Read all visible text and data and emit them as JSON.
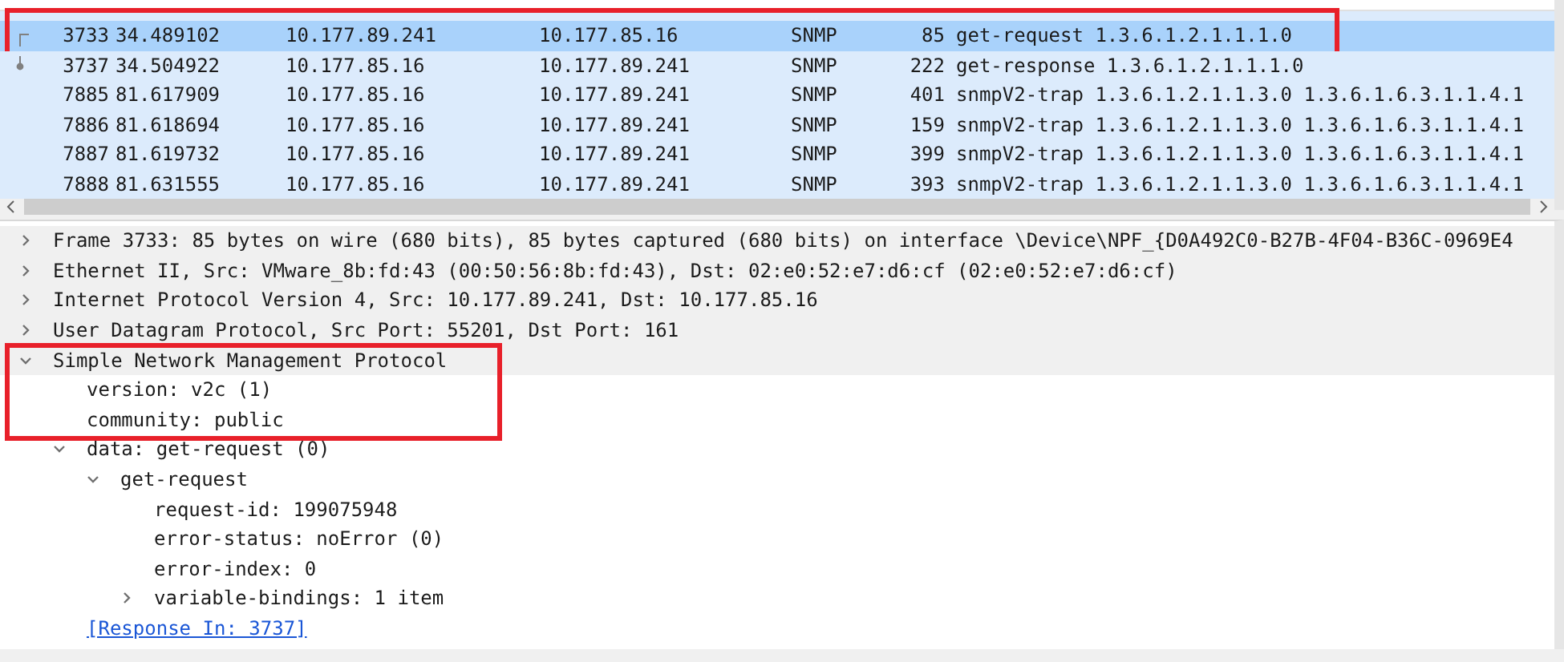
{
  "packet_list": {
    "rows": [
      {
        "no": "3733",
        "time": "34.489102",
        "source": "10.177.89.241",
        "destination": "10.177.85.16",
        "protocol": "SNMP",
        "length": "85",
        "info": "get-request 1.3.6.1.2.1.1.1.0",
        "selected": true,
        "highlighted": true,
        "request_mark": true,
        "response_mark": false
      },
      {
        "no": "3737",
        "time": "34.504922",
        "source": "10.177.85.16",
        "destination": "10.177.89.241",
        "protocol": "SNMP",
        "length": "222",
        "info": "get-response 1.3.6.1.2.1.1.1.0",
        "selected": false,
        "highlighted": false,
        "request_mark": false,
        "response_mark": true
      },
      {
        "no": "7885",
        "time": "81.617909",
        "source": "10.177.85.16",
        "destination": "10.177.89.241",
        "protocol": "SNMP",
        "length": "401",
        "info": "snmpV2-trap 1.3.6.1.2.1.1.3.0 1.3.6.1.6.3.1.1.4.1",
        "selected": false,
        "highlighted": false,
        "request_mark": false,
        "response_mark": false
      },
      {
        "no": "7886",
        "time": "81.618694",
        "source": "10.177.85.16",
        "destination": "10.177.89.241",
        "protocol": "SNMP",
        "length": "159",
        "info": "snmpV2-trap 1.3.6.1.2.1.1.3.0 1.3.6.1.6.3.1.1.4.1",
        "selected": false,
        "highlighted": false,
        "request_mark": false,
        "response_mark": false
      },
      {
        "no": "7887",
        "time": "81.619732",
        "source": "10.177.85.16",
        "destination": "10.177.89.241",
        "protocol": "SNMP",
        "length": "399",
        "info": "snmpV2-trap 1.3.6.1.2.1.1.3.0 1.3.6.1.6.3.1.1.4.1",
        "selected": false,
        "highlighted": false,
        "request_mark": false,
        "response_mark": false
      },
      {
        "no": "7888",
        "time": "81.631555",
        "source": "10.177.85.16",
        "destination": "10.177.89.241",
        "protocol": "SNMP",
        "length": "393",
        "info": "snmpV2-trap 1.3.6.1.2.1.1.3.0 1.3.6.1.6.3.1.1.4.1",
        "selected": false,
        "highlighted": false,
        "request_mark": false,
        "response_mark": false
      }
    ]
  },
  "packet_details": [
    {
      "label": "Frame 3733: 85 bytes on wire (680 bits), 85 bytes captured (680 bits) on interface \\Device\\NPF_{D0A492C0-B27B-4F04-B36C-0969E4",
      "expanded": false,
      "shaded": true,
      "highlighted": false
    },
    {
      "label": "Ethernet II, Src: VMware_8b:fd:43 (00:50:56:8b:fd:43), Dst: 02:e0:52:e7:d6:cf (02:e0:52:e7:d6:cf)",
      "expanded": false,
      "shaded": true,
      "highlighted": false
    },
    {
      "label": "Internet Protocol Version 4, Src: 10.177.89.241, Dst: 10.177.85.16",
      "expanded": false,
      "shaded": true,
      "highlighted": false
    },
    {
      "label": "User Datagram Protocol, Src Port: 55201, Dst Port: 161",
      "expanded": false,
      "shaded": true,
      "highlighted": false
    },
    {
      "label": "Simple Network Management Protocol",
      "expanded": true,
      "shaded": true,
      "highlighted": true,
      "children": [
        {
          "label": "version: v2c (1)",
          "shaded": false,
          "highlighted": true
        },
        {
          "label": "community: public",
          "shaded": false,
          "highlighted": true
        },
        {
          "label": "data: get-request (0)",
          "expanded": true,
          "shaded": false,
          "highlighted": false,
          "children": [
            {
              "label": "get-request",
              "expanded": true,
              "shaded": false,
              "highlighted": false,
              "children": [
                {
                  "label": "request-id: 199075948",
                  "shaded": false,
                  "highlighted": false
                },
                {
                  "label": "error-status: noError (0)",
                  "shaded": false,
                  "highlighted": false
                },
                {
                  "label": "error-index: 0",
                  "shaded": false,
                  "highlighted": false
                },
                {
                  "label": "variable-bindings: 1 item",
                  "expanded": false,
                  "shaded": false,
                  "highlighted": false
                }
              ]
            }
          ]
        },
        {
          "label": "[Response In: 3737]",
          "kind": "link",
          "shaded": false,
          "highlighted": false
        }
      ]
    }
  ]
}
